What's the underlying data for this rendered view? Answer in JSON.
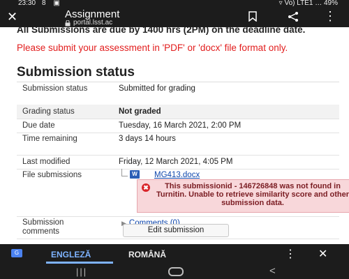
{
  "status_bar": {
    "time": "23:30",
    "left_icons": "8 ▣",
    "right_indicators": "▿ Vo) LTE1 … 49%"
  },
  "app_bar": {
    "title": "Assignment",
    "url": "portal.lsst.ac",
    "icons": [
      "close-icon",
      "lock-icon",
      "bookmark-icon",
      "share-icon",
      "more-vert-icon"
    ]
  },
  "page": {
    "notice_bold": "All Submissions are due by 1400 hrs (2PM) on the deadline date.",
    "notice_red": "Please submit your assessment in 'PDF' or 'docx' file format only.",
    "notice_red_color": "#e21d1d",
    "heading": "Submission status",
    "rows": [
      {
        "label": "Submission status",
        "value": "Submitted for grading"
      },
      {
        "label": "Grading status",
        "value": "Not graded"
      },
      {
        "label": "Due date",
        "value": "Tuesday, 16 March 2021, 2:00 PM"
      },
      {
        "label": "Time remaining",
        "value": "3 days 14 hours"
      },
      {
        "label": "Last modified",
        "value": "Friday, 12 March 2021, 4:05 PM"
      },
      {
        "label": "File submissions",
        "value": ""
      },
      {
        "label": "Submission comments",
        "value": ""
      }
    ],
    "file": {
      "icon_text": "W",
      "name": "MG413.docx",
      "error_text": "This submissionid - 146726848 was not found in Turnitin. Unable to retrieve similarity score and other submission data.",
      "error_icon": "✖"
    },
    "comments_link": "Comments (0)",
    "edit_button": "Edit submission"
  },
  "translate_bar": {
    "icon_text": "G",
    "lang_active": "ENGLEZĂ",
    "lang_other": "ROMÂNĂ",
    "accent": "#7eb3ff"
  },
  "nav_bar": {
    "icons": [
      "recent-apps-icon",
      "home-icon",
      "back-icon"
    ]
  }
}
